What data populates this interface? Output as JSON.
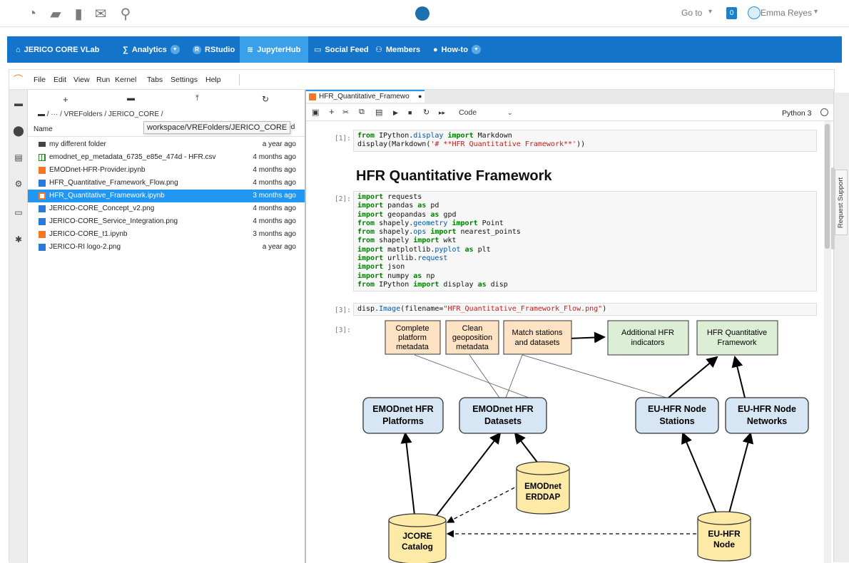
{
  "topbar": {
    "icons": [
      "dashboard-icon",
      "folder-icon",
      "book-icon",
      "mail-icon",
      "search-icon"
    ],
    "goto_label": "Go to",
    "notif_count": "0",
    "user_name": "Emma Reyes"
  },
  "navbar": {
    "items": [
      {
        "label": "JERICO CORE VLab",
        "icon": "⌂"
      },
      {
        "label": "Analytics",
        "icon": "∑"
      },
      {
        "label": "RStudio",
        "icon": "R"
      },
      {
        "label": "JupyterHub",
        "icon": "≋"
      },
      {
        "label": "Social Feed",
        "icon": "▭"
      },
      {
        "label": "Members",
        "icon": "⚇"
      },
      {
        "label": "How-to",
        "icon": "●"
      }
    ]
  },
  "menubar": {
    "items": [
      "File",
      "Edit",
      "View",
      "Run",
      "Kernel",
      "Tabs",
      "Settings",
      "Help"
    ]
  },
  "filebrowser": {
    "breadcrumb": "/ ··· / VREFolders / JERICO_CORE /",
    "tooltip": "workspace/VREFolders/JERICO_CORE",
    "col_name": "Name",
    "col_modified": "ified",
    "files": [
      {
        "name": "my different folder",
        "modified": "a year ago",
        "type": "folder"
      },
      {
        "name": "emodnet_ep_metadata_6735_e85e_474d - HFR.csv",
        "modified": "4 months ago",
        "type": "csv"
      },
      {
        "name": "EMODnet-HFR-Provider.ipynb",
        "modified": "4 months ago",
        "type": "notebook"
      },
      {
        "name": "HFR_Quantitative_Framework_Flow.png",
        "modified": "4 months ago",
        "type": "image"
      },
      {
        "name": "HFR_Quantitative_Framework.ipynb",
        "modified": "3 months ago",
        "type": "notebook"
      },
      {
        "name": "JERICO-CORE_Concept_v2.png",
        "modified": "4 months ago",
        "type": "image"
      },
      {
        "name": "JERICO-CORE_Service_Integration.png",
        "modified": "4 months ago",
        "type": "image"
      },
      {
        "name": "JERICO-CORE_t1.ipynb",
        "modified": "3 months ago",
        "type": "notebook"
      },
      {
        "name": "JERICO-RI logo-2.png",
        "modified": "a year ago",
        "type": "image"
      }
    ]
  },
  "notebook": {
    "tab_label": "HFR_Quantitative_Framewo",
    "cell_type": "Code",
    "kernel": "Python 3",
    "prompts": [
      "[1]:",
      "[2]:",
      "[3]:",
      "[3]:"
    ],
    "md_title": "HFR Quantitative Framework"
  },
  "flowchart": {
    "orange": [
      "Complete platform metadata",
      "Clean geoposition metadata",
      "Match stations and datasets"
    ],
    "green": [
      "Additional HFR indicators",
      "HFR Quantitative Framework"
    ],
    "blue": [
      "EMODnet HFR Platforms",
      "EMODnet HFR Datasets",
      "EU-HFR Node Stations",
      "EU-HFR Node Networks"
    ],
    "db": [
      "EMODnet ERDDAP",
      "JCORE Catalog",
      "EU-HFR Node"
    ]
  },
  "right_sidebar": {
    "request_support": "Request Support"
  },
  "colors": {
    "nav_bg": "#1474c9",
    "nav_active": "#3aa0ea",
    "selection": "#2196f3",
    "notebook_orange": "#f37726",
    "box_orange": "#fde2c4",
    "box_green": "#dcefd6",
    "box_blue": "#d7e6f5",
    "db_yellow": "#fdeaa7"
  }
}
